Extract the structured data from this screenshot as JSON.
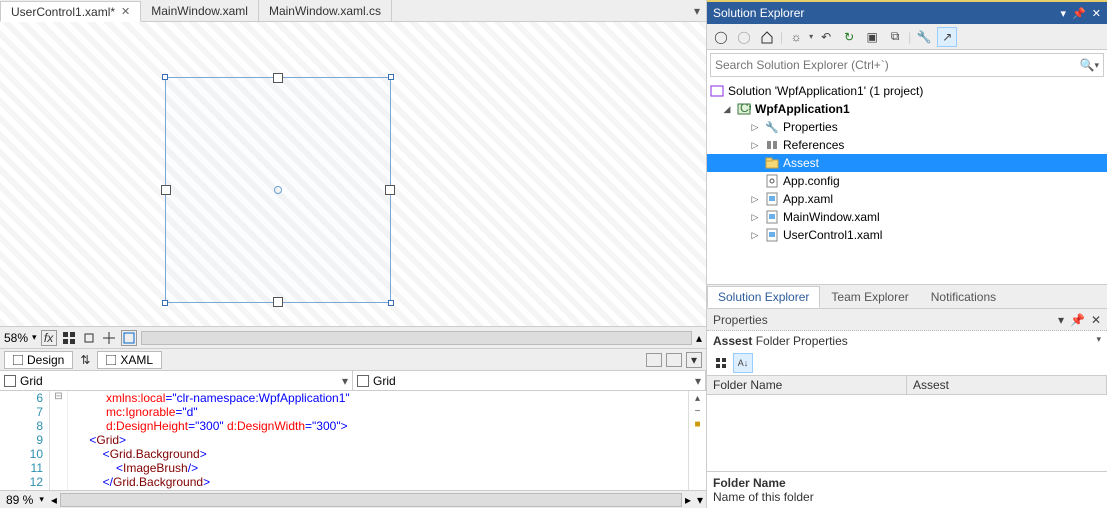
{
  "tabs": [
    {
      "label": "UserControl1.xaml*",
      "active": true,
      "closeable": true
    },
    {
      "label": "MainWindow.xaml",
      "active": false,
      "closeable": false
    },
    {
      "label": "MainWindow.xaml.cs",
      "active": false,
      "closeable": false
    }
  ],
  "zoom": {
    "value": "58%",
    "bottom": "89 %"
  },
  "switch": {
    "design": "Design",
    "xaml": "XAML"
  },
  "gridcombo": {
    "left": "Grid",
    "right": "Grid"
  },
  "code": {
    "lines": [
      {
        "n": 6,
        "html": "         <span class='k-attr'>xmlns:local</span><span class='k-br'>=</span><span class='k-br'>\"clr-namespace:WpfApplication1\"</span>"
      },
      {
        "n": 7,
        "html": "         <span class='k-attr'>mc:Ignorable</span><span class='k-br'>=</span><span class='k-br'>\"d\"</span>"
      },
      {
        "n": 8,
        "html": "         <span class='k-attr'>d:DesignHeight</span><span class='k-br'>=</span><span class='k-br'>\"300\"</span> <span class='k-attr'>d:DesignWidth</span><span class='k-br'>=</span><span class='k-br'>\"300\"</span><span class='k-br'>&gt;</span>"
      },
      {
        "n": 9,
        "html": "    <span class='k-br'>&lt;</span><span class='k-el'>Grid</span><span class='k-br'>&gt;</span>",
        "fold": true
      },
      {
        "n": 10,
        "html": "        <span class='k-br'>&lt;</span><span class='k-el'>Grid.Background</span><span class='k-br'>&gt;</span>"
      },
      {
        "n": 11,
        "html": "            <span class='k-br'>&lt;</span><span class='k-el'>ImageBrush</span><span class='k-br'>/&gt;</span>"
      },
      {
        "n": 12,
        "html": "        <span class='k-br'>&lt;/</span><span class='k-el'>Grid.Background</span><span class='k-br'>&gt;</span>"
      }
    ]
  },
  "solExplorer": {
    "title": "Solution Explorer",
    "searchPlaceholder": "Search Solution Explorer (Ctrl+`)",
    "solution": "Solution 'WpfApplication1' (1 project)",
    "project": "WpfApplication1",
    "items": [
      {
        "label": "Properties",
        "icon": "wrench",
        "exp": true,
        "depth": 2
      },
      {
        "label": "References",
        "icon": "refs",
        "exp": true,
        "depth": 2
      },
      {
        "label": "Assest",
        "icon": "folder",
        "exp": false,
        "depth": 2,
        "selected": true
      },
      {
        "label": "App.config",
        "icon": "config",
        "exp": false,
        "depth": 2
      },
      {
        "label": "App.xaml",
        "icon": "xaml",
        "exp": true,
        "depth": 2
      },
      {
        "label": "MainWindow.xaml",
        "icon": "xaml",
        "exp": true,
        "depth": 2
      },
      {
        "label": "UserControl1.xaml",
        "icon": "xaml",
        "exp": true,
        "depth": 2
      }
    ],
    "subtabs": [
      "Solution Explorer",
      "Team Explorer",
      "Notifications"
    ]
  },
  "properties": {
    "title": "Properties",
    "obj": "Assest",
    "objtype": "Folder Properties",
    "col1": "Folder Name",
    "val1": "Assest",
    "descTitle": "Folder Name",
    "descText": "Name of this folder"
  }
}
